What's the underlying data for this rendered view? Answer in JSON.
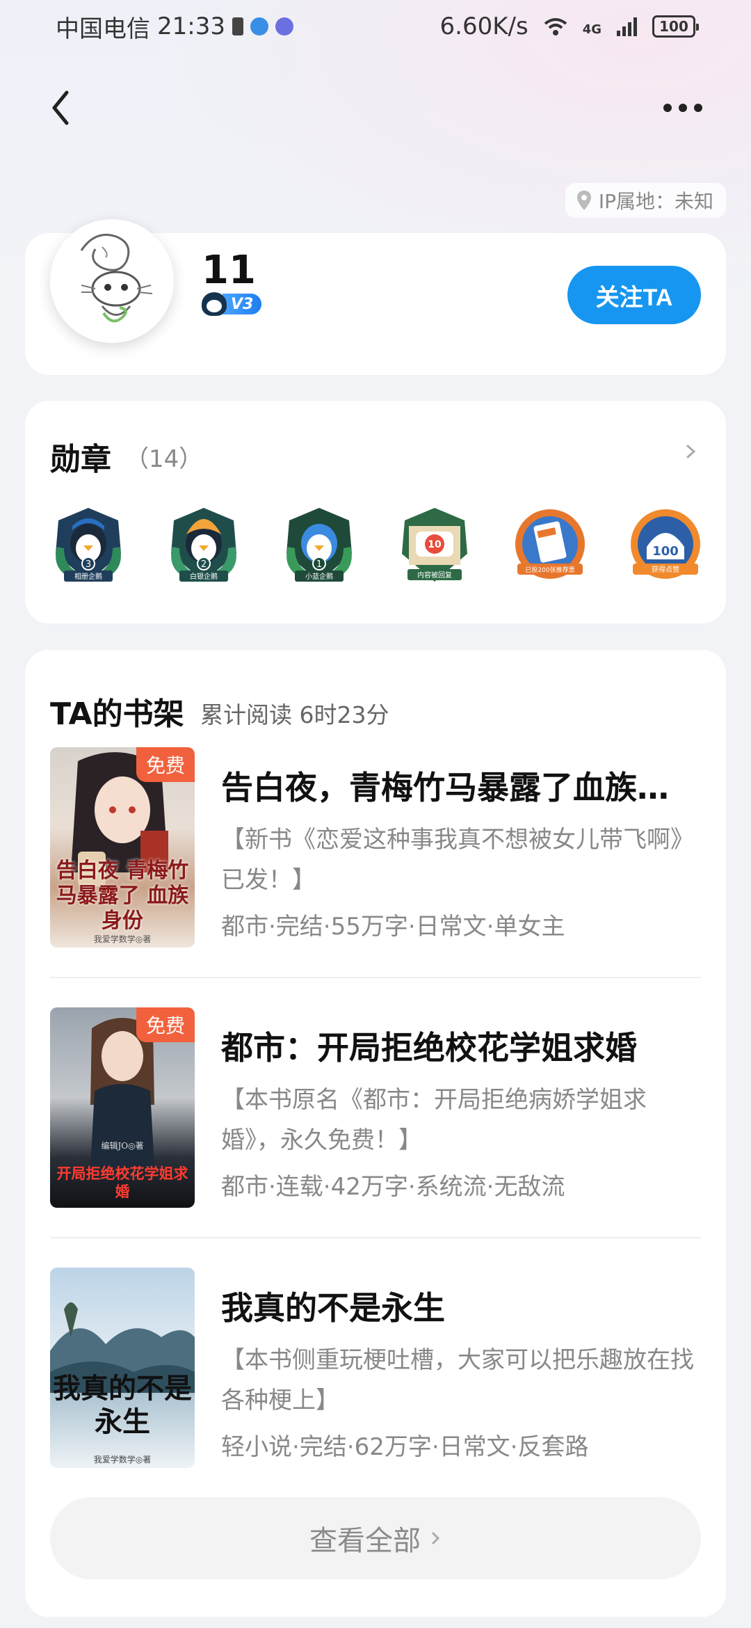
{
  "status_bar": {
    "carrier": "中国电信",
    "time": "21:33",
    "net_speed": "6.60K/s",
    "network": "4G",
    "battery": "100"
  },
  "profile": {
    "ip_location": "IP属地：未知",
    "username": "11",
    "vip_level": "V3",
    "follow_label": "关注TA"
  },
  "medals": {
    "title": "勋章",
    "count": "（14）",
    "items": [
      {
        "label": "相册企鹅",
        "number": "3",
        "color": "#2a6fbf"
      },
      {
        "label": "白银企鹅",
        "number": "2",
        "color": "#f2a33a"
      },
      {
        "label": "小蓝企鹅",
        "number": "1",
        "color": "#3b8be0"
      },
      {
        "label": "内容被回复",
        "number": "10",
        "color": "#e74c3c"
      },
      {
        "label": "已投200张推荐票",
        "number": "",
        "color": "#e8772e"
      },
      {
        "label": "获得点赞",
        "number": "100",
        "color": "#f08a2c"
      }
    ]
  },
  "bookshelf": {
    "title": "TA的书架",
    "stat": "累计阅读 6时23分",
    "free_tag": "免费",
    "books": [
      {
        "title": "告白夜，青梅竹马暴露了血族…",
        "desc": "【新书《恋爱这种事我真不想被女儿带飞啊》已发！】",
        "meta": "都市·完结·55万字·日常文·单女主",
        "free": true,
        "cover_text": "告白夜 青梅竹马暴露了 血族身份",
        "cover_author": "我爱学数学◎著"
      },
      {
        "title": "都市：开局拒绝校花学姐求婚",
        "desc": "【本书原名《都市：开局拒绝病娇学姐求婚》，永久免费！】",
        "meta": "都市·连载·42万字·系统流·无敌流",
        "free": true,
        "cover_text": "开局拒绝校花学姐求婚",
        "cover_author": "编辑JO◎著"
      },
      {
        "title": "我真的不是永生",
        "desc": "【本书侧重玩梗吐槽，大家可以把乐趣放在找各种梗上】",
        "meta": "轻小说·完结·62万字·日常文·反套路",
        "free": false,
        "cover_text": "我真的不是永生",
        "cover_author": "我爱学数学◎著"
      }
    ],
    "view_all": "查看全部"
  }
}
